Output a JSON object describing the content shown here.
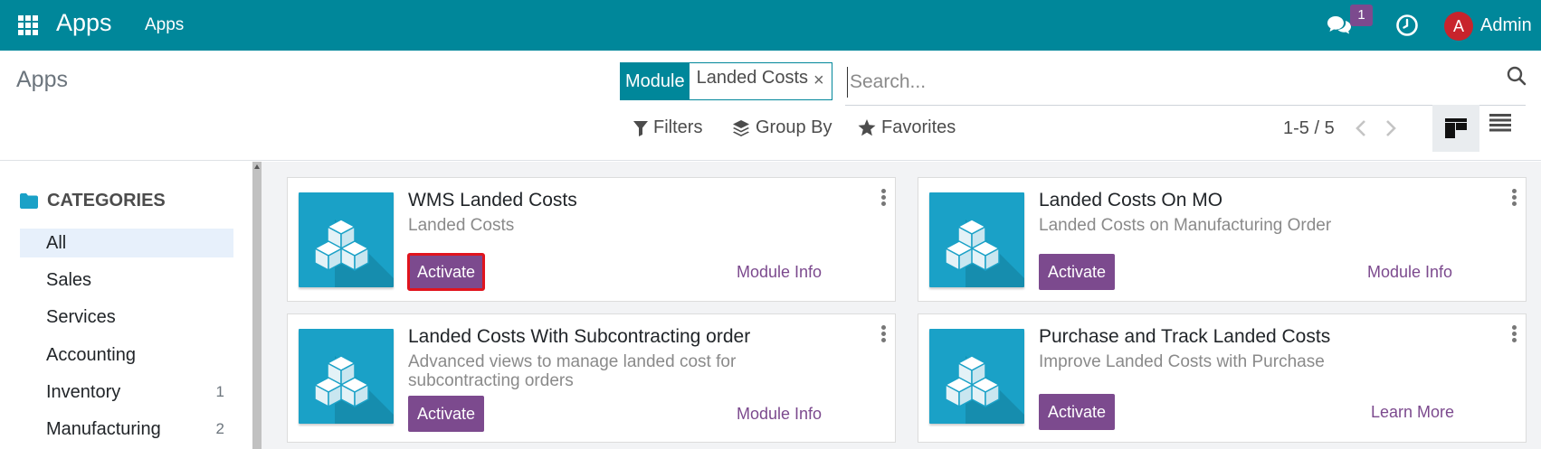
{
  "navbar": {
    "brand": "Apps",
    "menu_item": "Apps",
    "chat_badge": "1",
    "user_initial": "A",
    "user_name": "Admin"
  },
  "control": {
    "title": "Apps",
    "facet_label": "Module",
    "facet_value": "Landed Costs",
    "search_placeholder": "Search...",
    "filters_label": "Filters",
    "groupby_label": "Group By",
    "favorites_label": "Favorites",
    "pager": "1-5 / 5"
  },
  "sidebar": {
    "header": "CATEGORIES",
    "items": [
      {
        "label": "All",
        "count": ""
      },
      {
        "label": "Sales",
        "count": ""
      },
      {
        "label": "Services",
        "count": ""
      },
      {
        "label": "Accounting",
        "count": ""
      },
      {
        "label": "Inventory",
        "count": "1"
      },
      {
        "label": "Manufacturing",
        "count": "2"
      }
    ]
  },
  "cards": [
    {
      "title": "WMS Landed Costs",
      "summary": "Landed Costs",
      "button": "Activate",
      "link": "Module Info"
    },
    {
      "title": "Landed Costs On MO",
      "summary": "Landed Costs on Manufacturing Order",
      "button": "Activate",
      "link": "Module Info"
    },
    {
      "title": "Landed Costs With Subcontracting order",
      "summary": "Advanced views to manage landed cost for subcontracting orders",
      "button": "Activate",
      "link": "Module Info"
    },
    {
      "title": "Purchase and Track Landed Costs",
      "summary": "Improve Landed Costs with Purchase",
      "button": "Activate",
      "link": "Learn More"
    }
  ],
  "colors": {
    "navbar": "#00879a",
    "button": "#7c4a8e",
    "icon_bg": "#1aa1c7",
    "focus_outline": "#e0141e"
  }
}
